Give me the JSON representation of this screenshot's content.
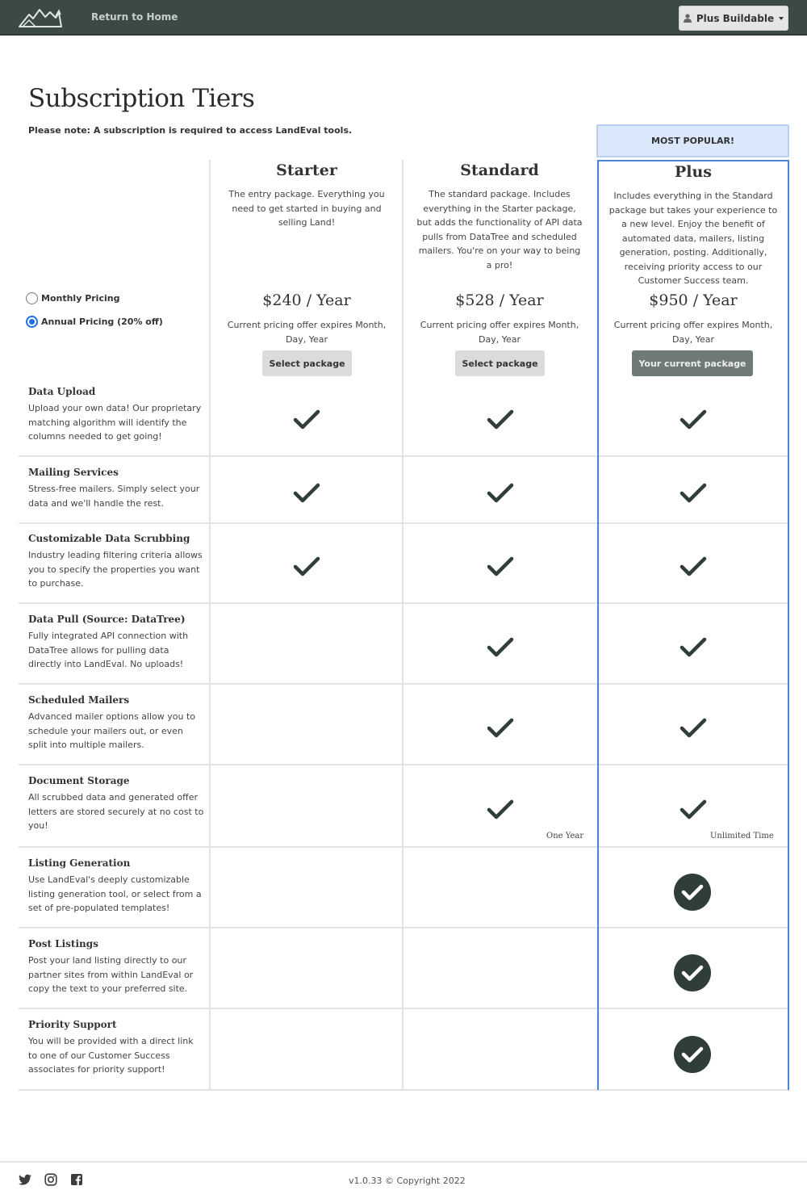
{
  "nav": {
    "home_link": "Return to Home",
    "user_menu": "Plus Buildable"
  },
  "page": {
    "title": "Subscription Tiers",
    "note": "Please note: A subscription is required to access LandEval tools.",
    "popular_badge": "MOST POPULAR!"
  },
  "pricing": {
    "monthly_label": "Monthly Pricing",
    "annual_label": "Annual Pricing (20% off)",
    "selected": "annual"
  },
  "tiers": [
    {
      "name": "Starter",
      "description": "The entry package. Everything you need to get started in buying and selling Land!",
      "price": "$240 / Year",
      "expiry": "Current pricing offer expires Month, Day, Year",
      "button": "Select package"
    },
    {
      "name": "Standard",
      "description": "The standard package. Includes everything in the Starter package, but adds the functionality of API data pulls from DataTree and scheduled mailers. You're on your way to being a pro!",
      "price": "$528 / Year",
      "expiry": "Current pricing offer expires Month, Day, Year",
      "button": "Select package"
    },
    {
      "name": "Plus",
      "description": "Includes everything in the Standard package but takes your experience to a new level. Enjoy the benefit of automated data, mailers, listing generation, posting. Additionally, receiving priority access to our Customer Success team.",
      "price": "$950 / Year",
      "expiry": "Current pricing offer expires Month, Day, Year",
      "button": "Your current package"
    }
  ],
  "features": [
    {
      "name": "Data Upload",
      "description": "Upload your own data! Our proprietary matching algorithm will identify the columns needed to get going!",
      "starter": true,
      "standard": true,
      "plus": true
    },
    {
      "name": "Mailing Services",
      "description": "Stress-free mailers. Simply select your data and we'll handle the rest.",
      "starter": true,
      "standard": true,
      "plus": true
    },
    {
      "name": "Customizable Data Scrubbing",
      "description": "Industry leading filtering criteria allows you to specify the properties you want to purchase.",
      "starter": true,
      "standard": true,
      "plus": true
    },
    {
      "name": "Data Pull (Source: DataTree)",
      "description": "Fully integrated API connection with DataTree allows for pulling data directly into LandEval. No uploads!",
      "starter": false,
      "standard": true,
      "plus": true
    },
    {
      "name": "Scheduled Mailers",
      "description": "Advanced mailer options allow you to schedule your mailers out, or even split into multiple mailers.",
      "starter": false,
      "standard": true,
      "plus": true
    },
    {
      "name": "Document Storage",
      "description": "All scrubbed data and generated offer letters are stored securely at no cost to you!",
      "starter": false,
      "standard": true,
      "plus": true,
      "standard_note": "One Year",
      "plus_note": "Unlimited Time"
    },
    {
      "name": "Listing Generation",
      "description": "Use LandEval's deeply customizable listing generation tool, or select from a set of pre-populated templates!",
      "starter": false,
      "standard": false,
      "plus": true
    },
    {
      "name": "Post Listings",
      "description": "Post your land listing directly to our partner sites from within LandEval or copy the text to your preferred site.",
      "starter": false,
      "standard": false,
      "plus": true
    },
    {
      "name": "Priority Support",
      "description": "You will be provided with a direct link to one of our Customer Success associates for priority support!",
      "starter": false,
      "standard": false,
      "plus": true
    }
  ],
  "footer": {
    "copyright": "v1.0.33 © Copyright 2022",
    "social_icons": [
      "twitter-icon",
      "instagram-icon",
      "facebook-icon"
    ]
  },
  "colors": {
    "navbar": "#3c4a44",
    "accent_blue": "#4a86d4",
    "check": "#2f3e38",
    "popular_bg": "#dbe7fb"
  }
}
